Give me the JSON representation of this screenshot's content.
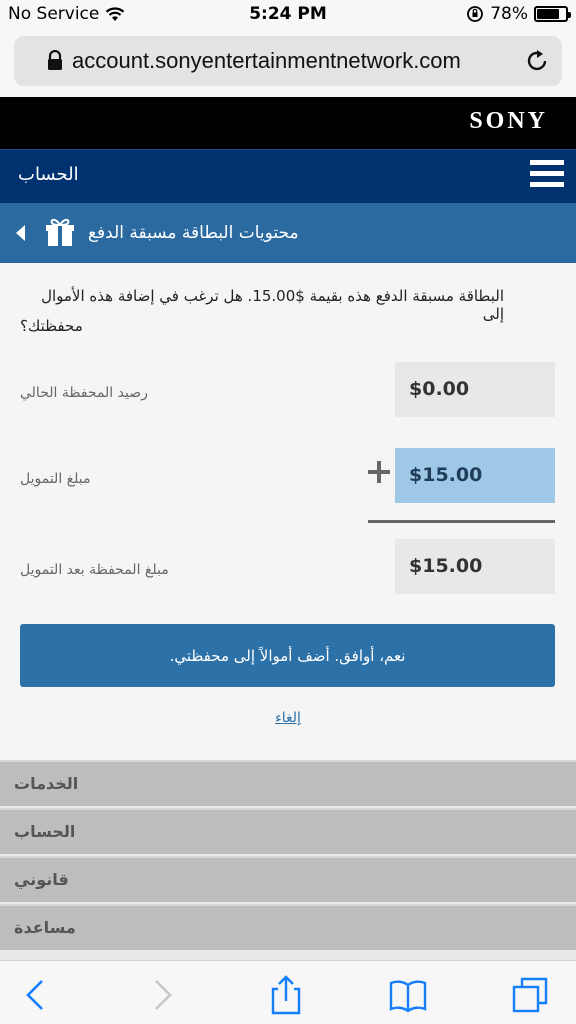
{
  "status_bar": {
    "carrier": "No Service",
    "time": "5:24 PM",
    "battery": "78%",
    "battery_level": 0.78
  },
  "browser": {
    "url": "account.sonyentertainmentnetwork.com"
  },
  "brand": {
    "logo": "SONY"
  },
  "nav": {
    "title": "الحساب"
  },
  "sub_header": {
    "title": "محتويات البطاقة مسبقة الدفع"
  },
  "main": {
    "description_line1": "البطاقة مسبقة الدفع هذه بقيمة $15.00. هل ترغب في إضافة هذه الأموال إلى",
    "description_line2": "محفظتك؟",
    "current_balance_label": "رصيد المحفظة الحالي",
    "current_balance_value": "$0.00",
    "funding_label": "مبلغ التمويل",
    "funding_value": "$15.00",
    "after_funding_label": "مبلغ المحفظة بعد التمويل",
    "after_funding_value": "$15.00",
    "confirm_button": ".نعم، أوافق. أضف أموالاً إلى محفظتي",
    "cancel_link": "إلغاء"
  },
  "footer_menu": {
    "items": [
      "الخدمات",
      "الحساب",
      "قانوني",
      "مساعدة"
    ]
  },
  "colors": {
    "nav_bg": "#003270",
    "sub_header_bg": "#2a6aa1",
    "button_bg": "#2c71a8",
    "active_field_bg": "#9ec8e6",
    "ios_blue": "#157efb"
  }
}
